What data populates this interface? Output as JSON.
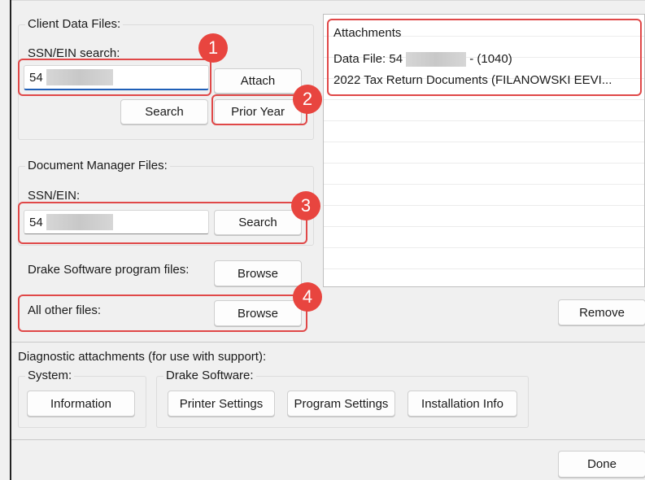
{
  "client_data": {
    "title": "Client Data Files:",
    "search_label": "SSN/EIN search:",
    "input_value": "54",
    "attach_label": "Attach",
    "search_label_btn": "Search",
    "prior_year_label": "Prior Year"
  },
  "doc_manager": {
    "title": "Document Manager Files:",
    "ssn_label": "SSN/EIN:",
    "input_value": "54",
    "search_label": "Search"
  },
  "drake_program": {
    "label": "Drake Software program files:",
    "browse_label": "Browse"
  },
  "other_files": {
    "label": "All other files:",
    "browse_label": "Browse"
  },
  "attachments": {
    "header": "Attachments",
    "items": [
      {
        "prefix": "Data File: 54",
        "suffix": "- (1040)"
      },
      {
        "text": "2022 Tax Return Documents (FILANOWSKI EEVI..."
      }
    ],
    "remove_label": "Remove"
  },
  "diagnostic": {
    "title": "Diagnostic attachments (for use with support):",
    "system_title": "System:",
    "information_label": "Information",
    "drake_title": "Drake Software:",
    "printer_label": "Printer Settings",
    "program_label": "Program Settings",
    "install_label": "Installation Info"
  },
  "done_label": "Done",
  "badges": [
    "1",
    "2",
    "3",
    "4"
  ],
  "highlight_color": "#e04848"
}
